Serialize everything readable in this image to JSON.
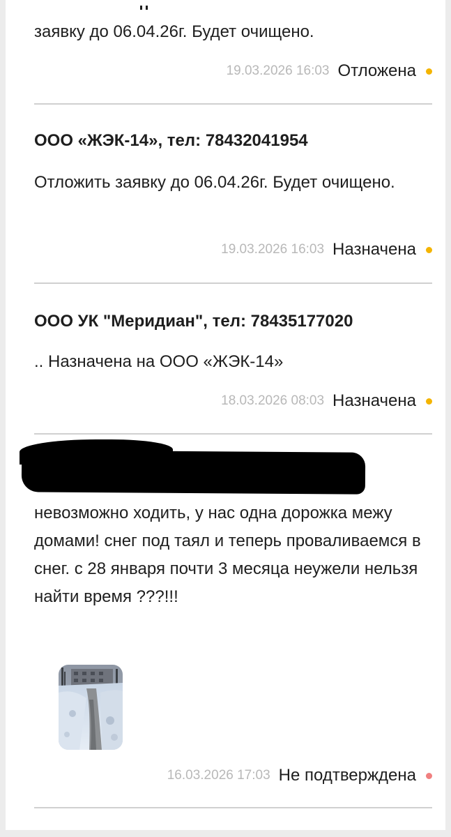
{
  "entries": [
    {
      "message_tail": "заявку до 06.04.26г. Будет очищено.",
      "time": "19.03.2026 16:03",
      "status": "Отложена",
      "status_color": "#f4b400"
    },
    {
      "author": "ООО «ЖЭК-14», тел: 78432041954",
      "message": "Отложить заявку до 06.04.26г. Будет очищено.",
      "time": "19.03.2026 16:03",
      "status": "Назначена",
      "status_color": "#f4b400"
    },
    {
      "author": "ООО УК \"Меридиан\", тел: 78435177020",
      "message": ".. Назначена на ООО «ЖЭК-14»",
      "time": "18.03.2026 08:03",
      "status": "Назначена",
      "status_color": "#f4b400"
    },
    {
      "message": "невозможно ходить, у нас одна дорожка межу домами! снег под таял и теперь проваливаемся в снег. с 28 января почти 3 месяца неужели нельзя найти время ???!!!",
      "time": "16.03.2026 17:03",
      "status": "Не подтверждена",
      "status_color": "#f08080"
    }
  ]
}
